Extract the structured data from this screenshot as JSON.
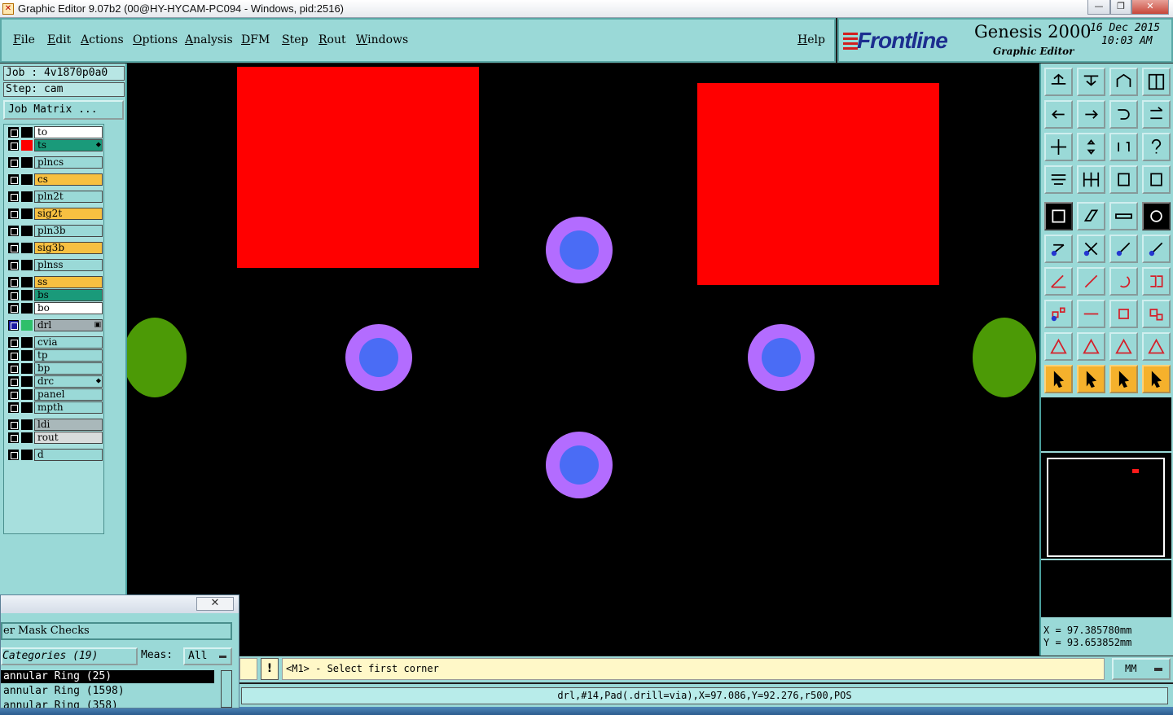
{
  "window": {
    "title": "Graphic Editor 9.07b2 (00@HY-HYCAM-PC094 - Windows, pid:2516)",
    "controls": {
      "minimize": "—",
      "maximize": "❐",
      "close": "✕"
    }
  },
  "menu": {
    "items": [
      "File",
      "Edit",
      "Actions",
      "Options",
      "Analysis",
      "DFM",
      "Step",
      "Rout",
      "Windows"
    ],
    "help": "Help"
  },
  "brand": {
    "logo": "Frontline",
    "product": "Genesis 2000",
    "subtitle": "Graphic Editor",
    "date": "16 Dec 2015",
    "time": "10:03 AM"
  },
  "job": {
    "job_line": "Job : 4v1870p0a0",
    "step_line": "Step: cam",
    "matrix_button": "Job Matrix ..."
  },
  "layers": [
    {
      "name": "to",
      "color": "#ffffff",
      "swatch": "#000000"
    },
    {
      "name": "ts",
      "color": "#1a9a7a",
      "swatch": "#ff0000",
      "mark": "⬥"
    },
    {
      "name": "plncs",
      "color": "#9ad9d7",
      "swatch": "#000000"
    },
    {
      "name": "cs",
      "color": "#f7c041",
      "swatch": "#000000"
    },
    {
      "name": "pln2t",
      "color": "#9ad9d7",
      "swatch": "#000000"
    },
    {
      "name": "sig2t",
      "color": "#f7c041",
      "swatch": "#000000"
    },
    {
      "name": "pln3b",
      "color": "#9ad9d7",
      "swatch": "#000000"
    },
    {
      "name": "sig3b",
      "color": "#f7c041",
      "swatch": "#000000"
    },
    {
      "name": "plnss",
      "color": "#9ad9d7",
      "swatch": "#000000"
    },
    {
      "name": "ss",
      "color": "#f7c041",
      "swatch": "#000000"
    },
    {
      "name": "bs",
      "color": "#1a9a7a",
      "swatch": "#000000"
    },
    {
      "name": "bo",
      "color": "#ffffff",
      "swatch": "#000000"
    },
    {
      "name": "drl",
      "color": "#a2aeb2",
      "swatch": "#2fbf6a",
      "mark": "▣",
      "active": true
    },
    {
      "name": "cvia",
      "color": "#9ad9d7",
      "swatch": "#000000"
    },
    {
      "name": "tp",
      "color": "#9ad9d7",
      "swatch": "#000000"
    },
    {
      "name": "bp",
      "color": "#9ad9d7",
      "swatch": "#000000"
    },
    {
      "name": "drc",
      "color": "#9ad9d7",
      "swatch": "#000000",
      "mark": "⬥"
    },
    {
      "name": "panel",
      "color": "#9ad9d7",
      "swatch": "#000000"
    },
    {
      "name": "mpth",
      "color": "#9ad9d7",
      "swatch": "#000000"
    },
    {
      "name": "ldi",
      "color": "#a9b8ba",
      "swatch": "#000000"
    },
    {
      "name": "rout",
      "color": "#d9dcdc",
      "swatch": "#000000"
    },
    {
      "name": "d",
      "color": "#9ad9d7",
      "swatch": "#000000"
    }
  ],
  "tools": [
    "save-step-icon",
    "open-step-icon",
    "home-icon",
    "split-view-icon",
    "zoom-back-icon",
    "zoom-forward-icon",
    "undo-zoom-icon",
    "redraw-icon",
    "zoom-fit-icon",
    "zoom-center-icon",
    "scale-1-2-icon",
    "help-icon",
    "snap-settings-icon",
    "grid-icon",
    "select-filter-icon",
    "feature-filter-icon",
    "pad-select-icon",
    "edit-outline-icon",
    "ruler-icon",
    "filled-circle-icon",
    "connect-nodes-icon",
    "cross-node-icon",
    "line-node-icon",
    "arc-node-icon",
    "angle-line-icon",
    "diagonal-line-icon",
    "rotate-arc-icon",
    "align-icon",
    "move-feature-icon",
    "horizontal-line-icon",
    "dimension-icon",
    "shapes-icon",
    "triangle-measure-icon",
    "triangle-point-icon",
    "triangle-top-icon",
    "triangle-side-icon",
    "pointer-icon",
    "pointer-box-icon",
    "pointer-circle-icon",
    "pointer-network-icon"
  ],
  "coords": {
    "x": "X = 97.385780mm",
    "y": "Y = 93.653852mm"
  },
  "status": {
    "warn_icon": "!",
    "prompt": "<M1> - Select first corner",
    "unit": "MM",
    "info": "drl,#14,Pad(.drill=via),X=97.086,Y=92.276,r500,POS"
  },
  "checks": {
    "title_close": "✕",
    "header": "er Mask Checks",
    "categories": "Categories (19)",
    "meas_label": "Meas:",
    "meas_value": "All",
    "items": [
      "annular Ring (25)",
      "annular Ring (1598)",
      "annular Ring (358)"
    ]
  }
}
